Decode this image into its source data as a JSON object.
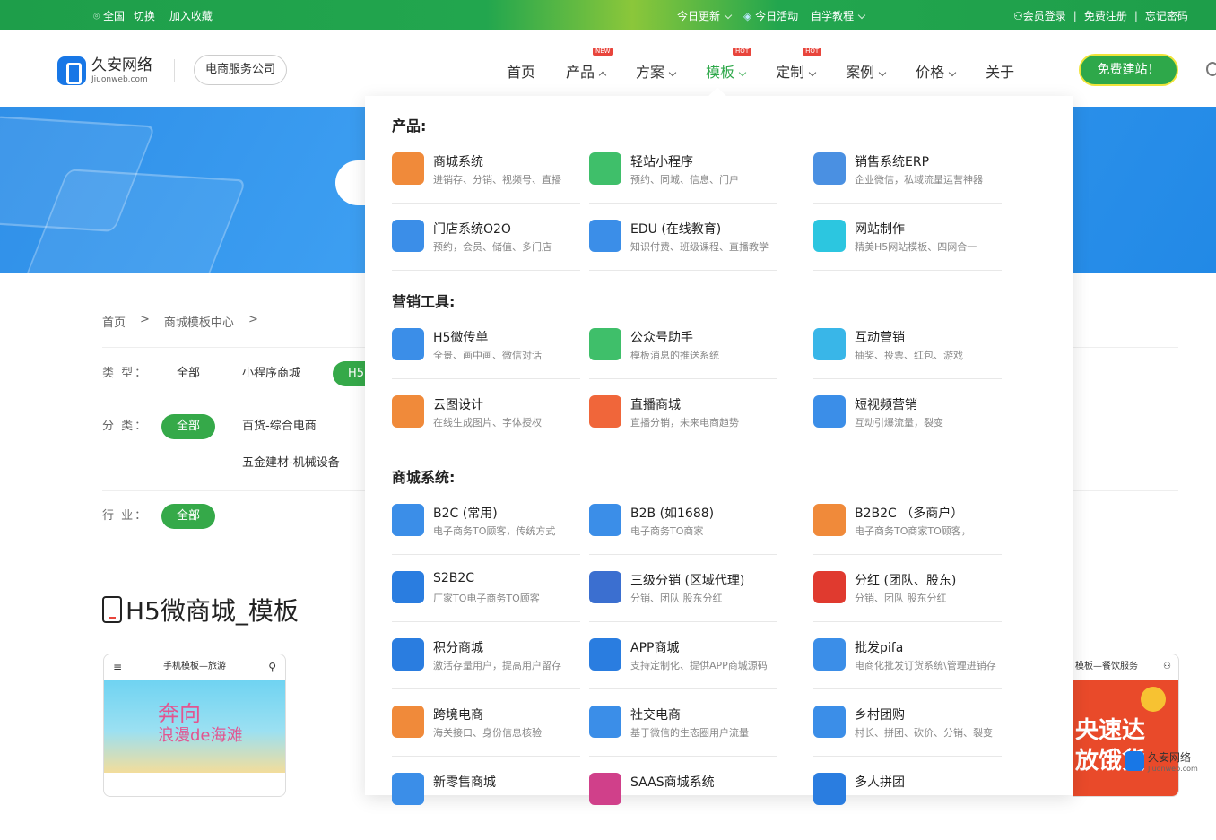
{
  "topbar": {
    "region": "全国",
    "switch": "切换",
    "favorite": "加入收藏",
    "today_update": "今日更新",
    "today_activity": "今日活动",
    "self_study": "自学教程",
    "login": "会员登录",
    "register": "免费注册",
    "forgot": "忘记密码",
    "sep": "|"
  },
  "brand": {
    "name": "久安网络",
    "domain": "Jiuonweb.com",
    "company_tag": "电商服务公司"
  },
  "nav": {
    "items": [
      "首页",
      "产品",
      "方案",
      "模板",
      "定制",
      "案例",
      "价格",
      "关于"
    ],
    "badges": {
      "new": "NEW",
      "hot": "HOT"
    },
    "cta": "免费建站！"
  },
  "breadcrumb": [
    "首页",
    ">",
    "商城模板中心",
    ">"
  ],
  "filters": {
    "type_label": "类 型：",
    "type_options": [
      "全部",
      "小程序商城",
      "H5"
    ],
    "category_label": "分 类：",
    "category_options": [
      "全部",
      "百货-综合电商",
      "五金建材-机械设备"
    ],
    "industry_label": "行 业：",
    "industry_options": [
      "全部"
    ]
  },
  "page_title": "H5微商城_模板",
  "cards": [
    {
      "header": "手机模板—旅游",
      "line1": "奔向",
      "line2": "浪漫de海滩"
    },
    {
      "header": "模板—餐饮服务",
      "line1": "央速达",
      "line2": "放饿货"
    }
  ],
  "watermark": {
    "name": "久安网络",
    "domain": "Jiuonweb.com"
  },
  "dropdown": {
    "sections": [
      {
        "title": "产品:",
        "items": [
          {
            "title": "商城系统",
            "desc": "进销存、分销、视频号、直播",
            "icon": "shopping-bag-icon",
            "color": "#f08a3a"
          },
          {
            "title": "轻站小程序",
            "desc": "预约、同城、信息、门户",
            "icon": "miniapp-icon",
            "color": "#3fbf6a"
          },
          {
            "title": "销售系统ERP",
            "desc": "企业微信，私域流量运营神器",
            "icon": "erp-chart-icon",
            "color": "#4a90e2"
          },
          {
            "title": "门店系统O2O",
            "desc": "预约，会员、储值、多门店",
            "icon": "store-icon",
            "color": "#3b8ee8"
          },
          {
            "title": "EDU (在线教育)",
            "desc": "知识付费、班级课程、直播教学",
            "icon": "book-icon",
            "color": "#3b8ee8"
          },
          {
            "title": "网站制作",
            "desc": "精美H5网站模板、四网合一",
            "icon": "website-icon",
            "color": "#2cc6e0"
          }
        ]
      },
      {
        "title": "营销工具:",
        "items": [
          {
            "title": "H5微传单",
            "desc": "全景、画中画、微信对话",
            "icon": "h5-flyer-icon",
            "color": "#3b8ee8"
          },
          {
            "title": "公众号助手",
            "desc": "模板消息的推送系统",
            "icon": "chat-bubble-icon",
            "color": "#3fbf6a"
          },
          {
            "title": "互动营销",
            "desc": "抽奖、投票、红包、游戏",
            "icon": "gift-icon",
            "color": "#39b6e8"
          },
          {
            "title": "云图设计",
            "desc": "在线生成图片、字体授权",
            "icon": "image-icon",
            "color": "#f08a3a"
          },
          {
            "title": "直播商城",
            "desc": "直播分销，未来电商趋势",
            "icon": "live-camera-icon",
            "color": "#f0663a"
          },
          {
            "title": "短视频营销",
            "desc": "互动引爆流量，裂变",
            "icon": "tv-play-icon",
            "color": "#3b8ee8"
          }
        ]
      },
      {
        "title": "商城系统:",
        "items": [
          {
            "title": "B2C (常用)",
            "desc": "电子商务TO顾客，传统方式",
            "icon": "b2c-bag-icon",
            "color": "#3b8ee8"
          },
          {
            "title": "B2B (如1688)",
            "desc": "电子商务TO商家",
            "icon": "b2b-icon",
            "color": "#3b8ee8"
          },
          {
            "title": "B2B2C （多商户）",
            "desc": "电子商务TO商家TO顾客，",
            "icon": "location-pin-icon",
            "color": "#f08a3a"
          },
          {
            "title": "S2B2C",
            "desc": "厂家TO电子商务TO顾客",
            "icon": "factory-icon",
            "color": "#2a7de0"
          },
          {
            "title": "三级分销 (区域代理)",
            "desc": "分销、团队 股东分红",
            "icon": "network-icon",
            "color": "#3b6fd0"
          },
          {
            "title": "分红 (团队、股东)",
            "desc": "分销、团队 股东分红",
            "icon": "team-dividend-icon",
            "color": "#e03a2f"
          },
          {
            "title": "积分商城",
            "desc": "激活存量用户，提高用户留存",
            "icon": "points-coin-icon",
            "color": "#2a7de0"
          },
          {
            "title": "APP商城",
            "desc": "支持定制化、提供APP商城源码",
            "icon": "app-phone-icon",
            "color": "#2a7de0"
          },
          {
            "title": "批发pifa",
            "desc": "电商化批发订货系统\\管理进销存",
            "icon": "truck-icon",
            "color": "#3b8ee8"
          },
          {
            "title": "跨境电商",
            "desc": "海关接口、身份信息核验",
            "icon": "cross-border-icon",
            "color": "#f08a3a"
          },
          {
            "title": "社交电商",
            "desc": "基于微信的生态圈用户流量",
            "icon": "social-icon",
            "color": "#3b8ee8"
          },
          {
            "title": "乡村团购",
            "desc": "村长、拼团、砍价、分销、裂变",
            "icon": "community-icon",
            "color": "#3b8ee8"
          },
          {
            "title": "新零售商城",
            "desc": "",
            "icon": "retail-store-icon",
            "color": "#3b8ee8"
          },
          {
            "title": "SAAS商城系统",
            "desc": "",
            "icon": "saas-icon",
            "color": "#d0408a"
          },
          {
            "title": "多人拼团",
            "desc": "",
            "icon": "group-buy-icon",
            "color": "#2a7de0"
          }
        ]
      }
    ]
  }
}
